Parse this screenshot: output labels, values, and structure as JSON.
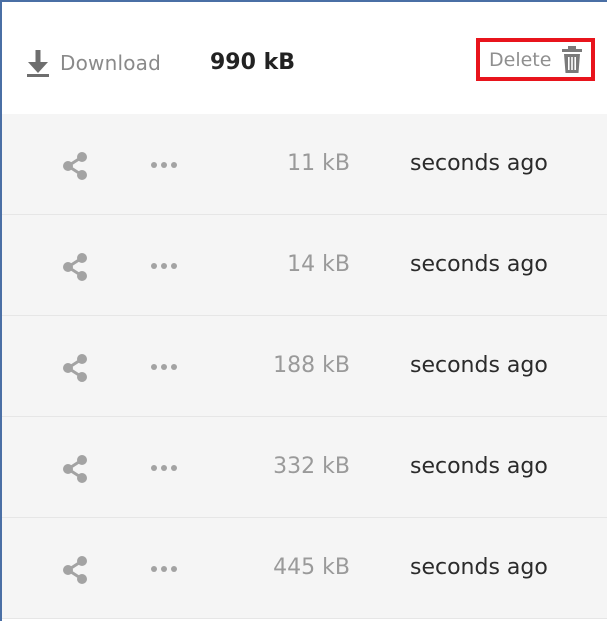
{
  "toolbar": {
    "download_label": "Download",
    "total_size": "990 kB",
    "delete_label": "Delete"
  },
  "files": [
    {
      "size": "11 kB",
      "time": "seconds ago"
    },
    {
      "size": "14 kB",
      "time": "seconds ago"
    },
    {
      "size": "188 kB",
      "time": "seconds ago"
    },
    {
      "size": "332 kB",
      "time": "seconds ago"
    },
    {
      "size": "445 kB",
      "time": "seconds ago"
    }
  ],
  "icons": {
    "download": "download-icon",
    "delete": "trash-icon",
    "share": "share-icon",
    "menu": "more-options-icon"
  },
  "colors": {
    "highlight": "#e8141c",
    "row_background": "#f5f5f5",
    "icon_gray": "#a3a3a3"
  }
}
